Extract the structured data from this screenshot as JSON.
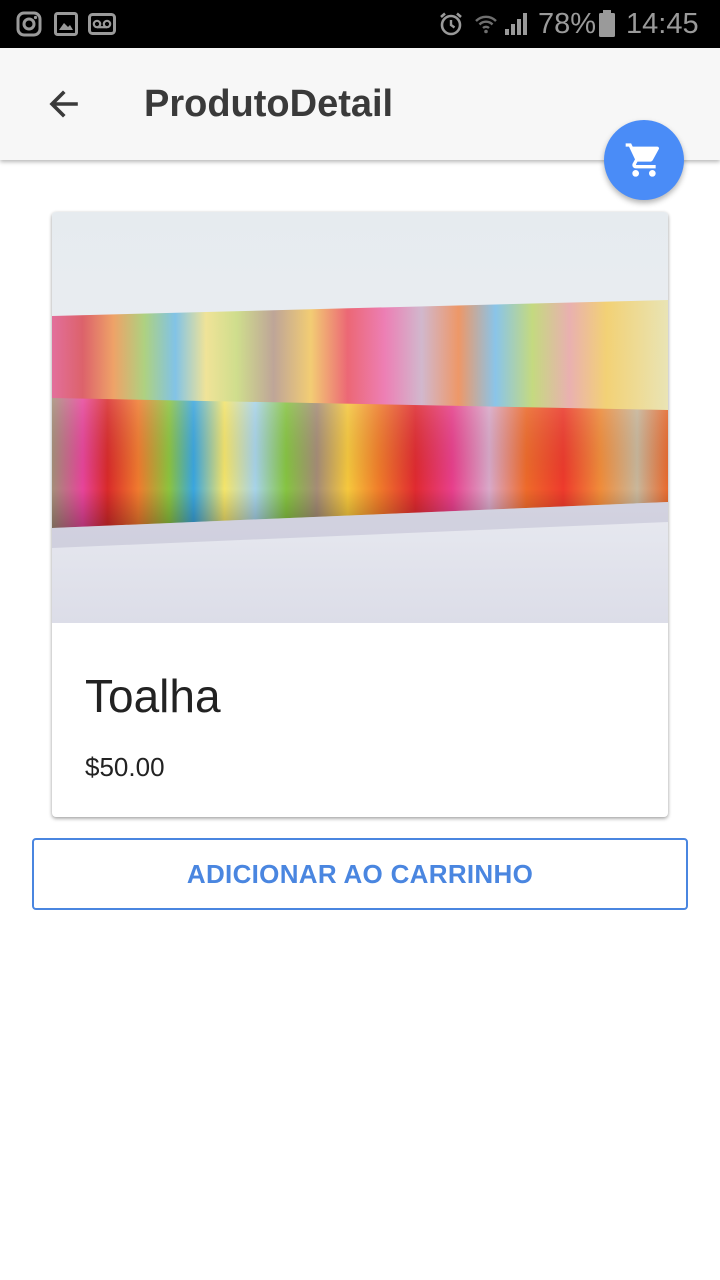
{
  "status_bar": {
    "icons_left": [
      "instagram-icon",
      "gallery-icon",
      "voicemail-icon"
    ],
    "icons_right": [
      "alarm-icon",
      "wifi-icon",
      "signal-icon",
      "battery-icon"
    ],
    "battery": "78%",
    "time": "14:45"
  },
  "app_bar": {
    "back_icon": "arrow-back-icon",
    "title": "ProdutoDetail"
  },
  "fab": {
    "icon": "shopping-cart-icon",
    "color": "#4a8cf7"
  },
  "product": {
    "name": "Toalha",
    "price": "$50.00",
    "image": "striped-rainbow-towel"
  },
  "actions": {
    "add_to_cart_label": "ADICIONAR AO CARRINHO",
    "accent_color": "#4a86e0"
  }
}
